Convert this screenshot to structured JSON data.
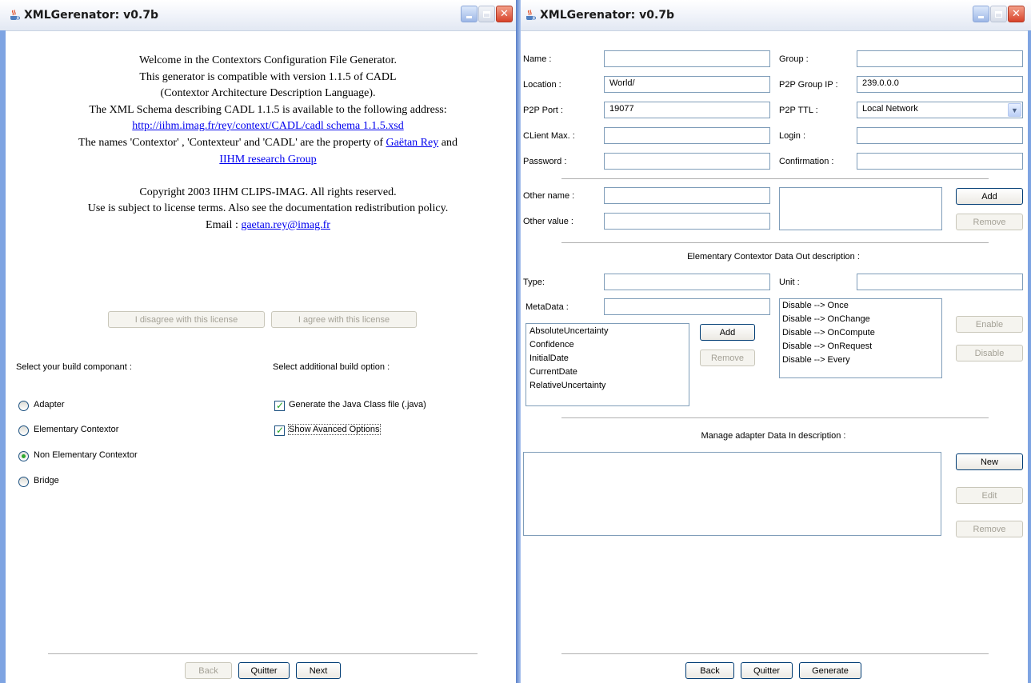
{
  "left_window": {
    "title": "XMLGerenator: v0.7b",
    "welcome": {
      "line1": "Welcome in the Contextors Configuration File Generator.",
      "line2": "This generator is compatible with version 1.1.5 of CADL",
      "line3": "(Contextor Architecture Description Language).",
      "line4": "The XML Schema describing CADL 1.1.5 is available to the following address:",
      "schema_link": "http://iihm.imag.fr/rey/context/CADL/cadl schema 1.1.5.xsd",
      "line5_prefix": "The names 'Contextor' , 'Contexteur' and 'CADL' are the property of ",
      "rey_link": "Gaëtan Rey",
      "line5_suffix": " and",
      "group_link": "IIHM research Group",
      "copyright1": "Copyright 2003 IIHM CLIPS-IMAG. All rights reserved.",
      "copyright2": "Use is subject to license terms. Also see the documentation redistribution policy.",
      "email_prefix": "Email : ",
      "email_link": "gaetan.rey@imag.fr"
    },
    "disagree_label": "I disagree with this license",
    "agree_label": "I agree with this license",
    "build_component_label": "Select your build componant :",
    "build_option_label": "Select additional build option :",
    "components": [
      {
        "label": "Adapter",
        "selected": false
      },
      {
        "label": "Elementary Contextor",
        "selected": false
      },
      {
        "label": "Non Elementary Contextor",
        "selected": true
      },
      {
        "label": "Bridge",
        "selected": false
      }
    ],
    "options": [
      {
        "label": "Generate the Java Class file (.java)",
        "checked": true
      },
      {
        "label": "Show Avanced Options",
        "checked": true
      }
    ],
    "back_label": "Back",
    "quit_label": "Quitter",
    "next_label": "Next"
  },
  "right_window": {
    "title": "XMLGerenator: v0.7b",
    "fields": {
      "name_label": "Name :",
      "name_value": "",
      "group_label": "Group :",
      "group_value": "",
      "location_label": "Location :",
      "location_value": "World/",
      "p2p_group_ip_label": "P2P Group IP :",
      "p2p_group_ip_value": "239.0.0.0",
      "p2p_port_label": "P2P Port :",
      "p2p_port_value": "19077",
      "p2p_ttl_label": "P2P TTL :",
      "p2p_ttl_value": "Local Network",
      "client_max_label": "CLient Max. :",
      "client_max_value": "",
      "login_label": "Login :",
      "login_value": "",
      "password_label": "Password :",
      "password_value": "",
      "confirmation_label": "Confirmation :",
      "confirmation_value": ""
    },
    "other": {
      "name_label": "Other name :",
      "value_label": "Other value :",
      "add_label": "Add",
      "remove_label": "Remove"
    },
    "data_out": {
      "section_title": "Elementary Contextor Data Out description :",
      "type_label": "Type:",
      "unit_label": "Unit :",
      "metadata_label": "MetaData :",
      "metadata_items": [
        "AbsoluteUncertainty",
        "Confidence",
        "InitialDate",
        "CurrentDate",
        "RelativeUncertainty"
      ],
      "add_label": "Add",
      "remove_label": "Remove",
      "triggers": [
        "Disable --> Once",
        "Disable --> OnChange",
        "Disable --> OnCompute",
        "Disable --> OnRequest",
        "Disable --> Every"
      ],
      "enable_label": "Enable",
      "disable_label": "Disable"
    },
    "data_in": {
      "section_title": "Manage adapter Data In description :",
      "new_label": "New",
      "edit_label": "Edit",
      "remove_label": "Remove"
    },
    "back_label": "Back",
    "quit_label": "Quitter",
    "generate_label": "Generate"
  },
  "colors": {
    "title_bar": "#e8edf5",
    "window_frame": "#7ea4e2",
    "close_button": "#d8432b",
    "link": "#0000ee",
    "check_mark": "#21a121"
  },
  "icons": {
    "app": "java-cup-icon",
    "minimize": "minimize-icon",
    "maximize": "maximize-icon",
    "close": "close-icon",
    "dropdown": "chevron-down-icon"
  }
}
